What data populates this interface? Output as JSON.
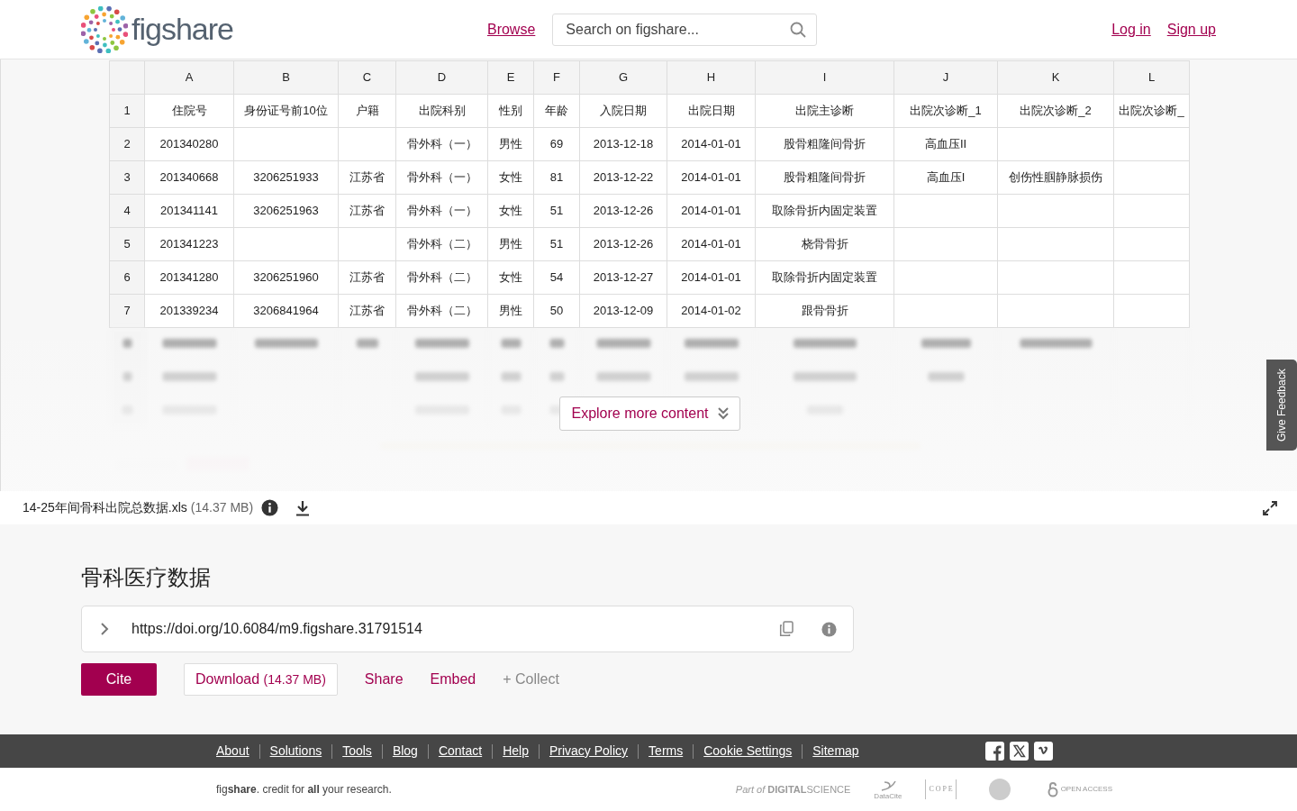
{
  "header": {
    "logo_text": "figshare",
    "nav_link": "Browse",
    "search": {
      "placeholder": "Search on figshare..."
    },
    "log_in": "Log in",
    "sign_up": "Sign up"
  },
  "spreadsheet": {
    "columns": [
      "A",
      "B",
      "C",
      "D",
      "E",
      "F",
      "G",
      "H",
      "I",
      "J",
      "K",
      "L"
    ],
    "rows": [
      {
        "number": "1",
        "cells": [
          "住院号",
          "身份证号前10位",
          "户籍",
          "出院科别",
          "性别",
          "年龄",
          "入院日期",
          "出院日期",
          "出院主诊断",
          "出院次诊断_1",
          "出院次诊断_2",
          "出院次诊断_"
        ]
      },
      {
        "number": "2",
        "cells": [
          "201340280",
          null,
          null,
          "骨外科（一）",
          "男性",
          "69",
          "2013-12-18",
          "2014-01-01",
          "股骨粗隆间骨折",
          "高血压II",
          null,
          null
        ]
      },
      {
        "number": "3",
        "cells": [
          "201340668",
          "3206251933",
          "江苏省",
          "骨外科（一）",
          "女性",
          "81",
          "2013-12-22",
          "2014-01-01",
          "股骨粗隆间骨折",
          "高血压I",
          "创伤性腘静脉损伤",
          null
        ]
      },
      {
        "number": "4",
        "cells": [
          "201341141",
          "3206251963",
          "江苏省",
          "骨外科（一）",
          "女性",
          "51",
          "2013-12-26",
          "2014-01-01",
          "取除骨折内固定装置",
          null,
          null,
          null
        ]
      },
      {
        "number": "5",
        "cells": [
          "201341223",
          null,
          null,
          "骨外科（二）",
          "男性",
          "51",
          "2013-12-26",
          "2014-01-01",
          "桡骨骨折",
          null,
          null,
          null
        ]
      },
      {
        "number": "6",
        "cells": [
          "201341280",
          "3206251960",
          "江苏省",
          "骨外科（二）",
          "女性",
          "54",
          "2013-12-27",
          "2014-01-01",
          "取除骨折内固定装置",
          null,
          null,
          null
        ]
      },
      {
        "number": "7",
        "cells": [
          "201339234",
          "3206841964",
          "江苏省",
          "骨外科（二）",
          "男性",
          "50",
          "2013-12-09",
          "2014-01-02",
          "跟骨骨折",
          null,
          null,
          null
        ]
      }
    ]
  },
  "explore_button": "Explore more content",
  "feedback_tab": "Give Feedback",
  "file": {
    "name": "14-25年间骨科出院总数据.xls",
    "size": "(14.37 MB)"
  },
  "item": {
    "title": "骨科医疗数据",
    "doi": "https://doi.org/10.6084/m9.figshare.31791514",
    "actions": {
      "cite": "Cite",
      "download": "Download",
      "download_size": "(14.37 MB)",
      "share": "Share",
      "embed": "Embed",
      "collect": "+ Collect"
    }
  },
  "footer": {
    "links": [
      "About",
      "Solutions",
      "Tools",
      "Blog",
      "Contact",
      "Help",
      "Privacy Policy",
      "Terms",
      "Cookie Settings",
      "Sitemap"
    ],
    "tagline": "fig**share**. credit for **all** your research.",
    "partners": [
      "*Part of* **DIGITAL**SCIENCE",
      "DataCite",
      "C O P E",
      "OPEN ACCESS"
    ]
  }
}
